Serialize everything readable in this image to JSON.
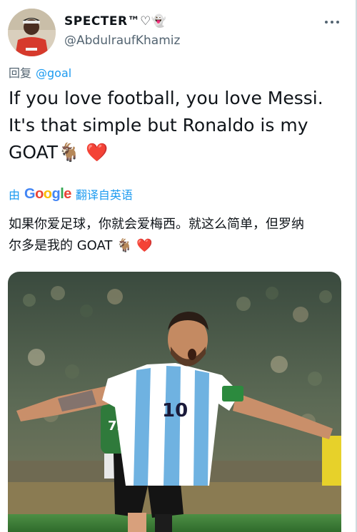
{
  "author": {
    "display_name": "SPECTER™♡👻",
    "handle": "@AbdulraufKhamiz"
  },
  "reply": {
    "prefix": "回复",
    "target": "@goal"
  },
  "tweet": {
    "line1": "If you love football, you love Messi.",
    "line2": "It's that simple but Ronaldo is my",
    "line3": "GOAT🐐 ❤️"
  },
  "translate": {
    "prefix": "由",
    "brand": "Google",
    "suffix": "翻译自英语"
  },
  "translation": {
    "line1": "如果你爱足球，你就会爱梅西。就这么简单，但罗纳",
    "line2": "尔多是我的 GOAT 🐐 ❤️"
  },
  "media": {
    "jersey_number": "10"
  },
  "colors": {
    "link": "#1d9bf0",
    "secondary_text": "#536471",
    "pitch_green": "#3f7f3a"
  },
  "icons": [
    "more-options-icon"
  ]
}
